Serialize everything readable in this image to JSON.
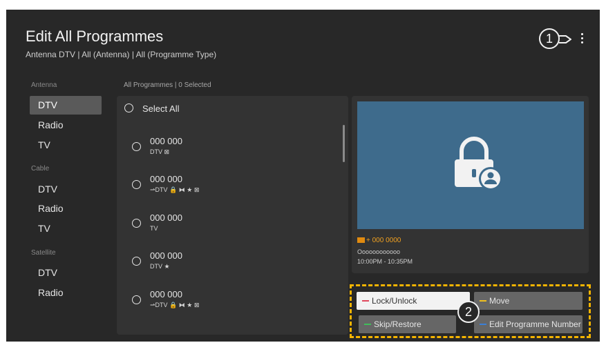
{
  "header": {
    "title": "Edit All Programmes",
    "subtitle": "Antenna DTV | All (Antenna) | All (Programme Type)"
  },
  "callouts": {
    "first": "1",
    "second": "2"
  },
  "sidebar": {
    "groups": [
      {
        "label": "Antenna",
        "items": [
          "DTV",
          "Radio",
          "TV"
        ]
      },
      {
        "label": "Cable",
        "items": [
          "DTV",
          "Radio",
          "TV"
        ]
      },
      {
        "label": "Satellite",
        "items": [
          "DTV",
          "Radio"
        ]
      }
    ]
  },
  "list": {
    "header": "All Programmes | 0 Selected",
    "select_all": "Select All",
    "programmes": [
      {
        "number": "000  000",
        "info": "DTV ⊠"
      },
      {
        "number": "000  000",
        "info": "⇀DTV 🔒 ⧓ ★ ⊠"
      },
      {
        "number": "000  000",
        "info": "TV"
      },
      {
        "number": "000  000",
        "info": "DTV ★"
      },
      {
        "number": "000  000",
        "info": "⇀DTV 🔒 ⧓ ★ ⊠"
      }
    ]
  },
  "preview": {
    "channel": "+ 000 0000",
    "name": "Oooooooooooo",
    "time": "10:00PM - 10:35PM"
  },
  "actions": {
    "lock_unlock": "Lock/Unlock",
    "move": "Move",
    "skip_restore": "Skip/Restore",
    "edit_number": "Edit Programme Number"
  },
  "colors": {
    "red": "#e0475b",
    "yellow": "#f0c020",
    "green": "#3fbf5a",
    "blue": "#3a7fd8",
    "highlight": "#f5b400"
  }
}
